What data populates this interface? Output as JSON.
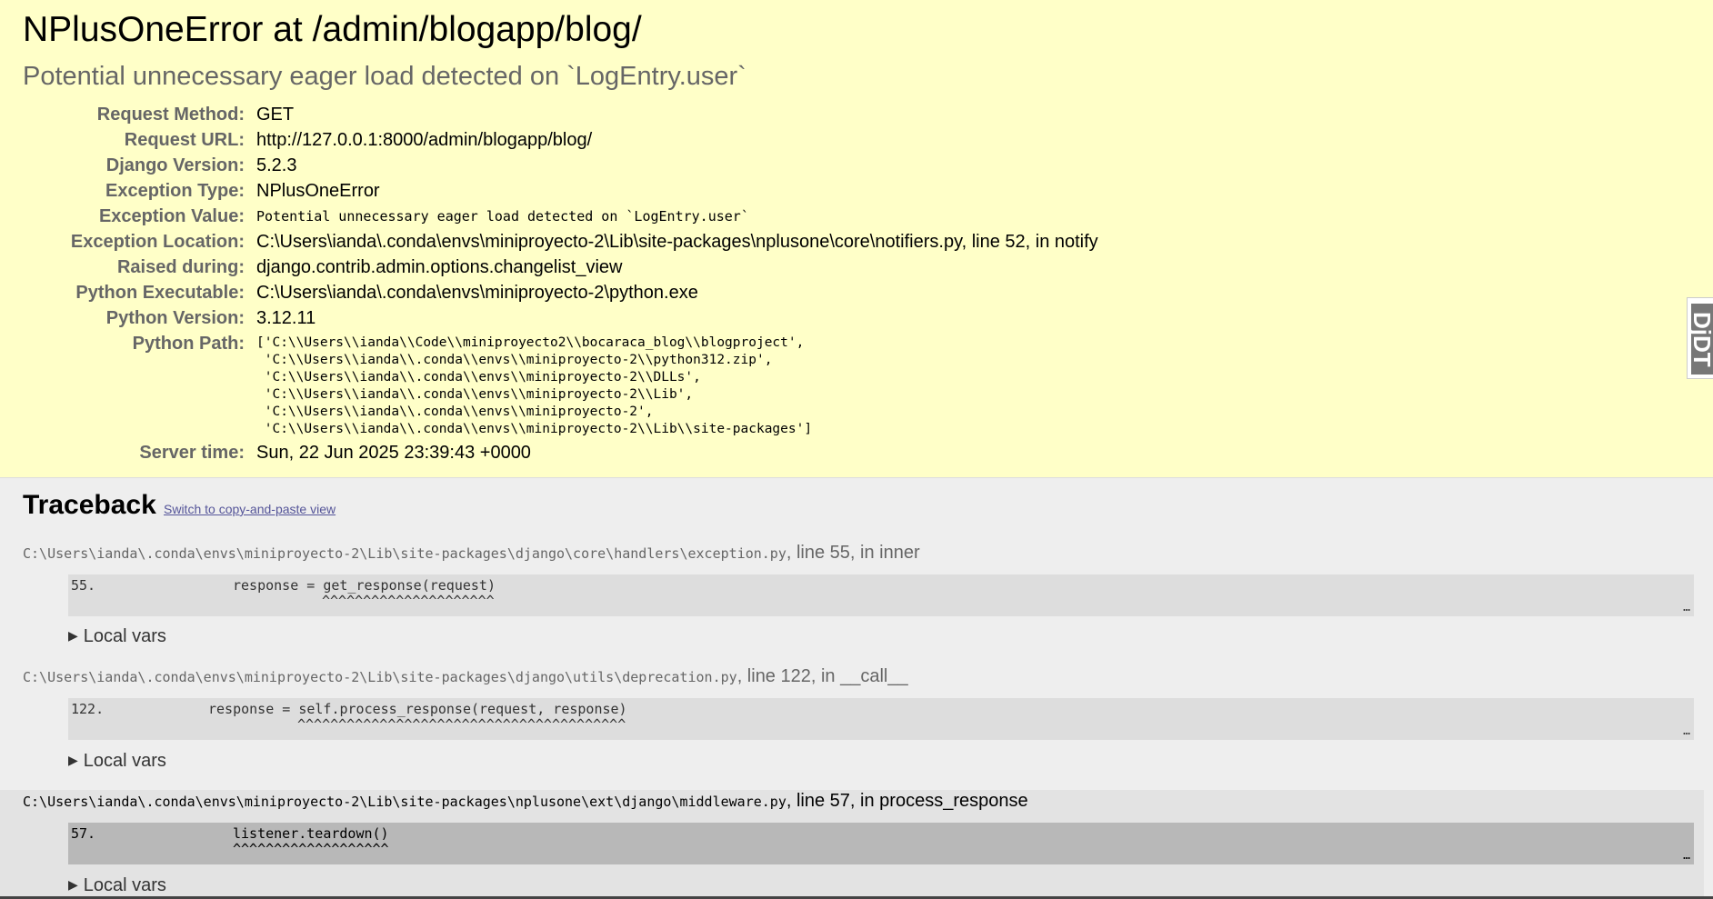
{
  "summary": {
    "title": "NPlusOneError at /admin/blogapp/blog/",
    "subtitle": "Potential unnecessary eager load detected on `LogEntry.user`",
    "meta": [
      {
        "label": "Request Method:",
        "value": "GET"
      },
      {
        "label": "Request URL:",
        "value": "http://127.0.0.1:8000/admin/blogapp/blog/"
      },
      {
        "label": "Django Version:",
        "value": "5.2.3"
      },
      {
        "label": "Exception Type:",
        "value": "NPlusOneError"
      },
      {
        "label": "Exception Value:",
        "value": "Potential unnecessary eager load detected on `LogEntry.user`"
      },
      {
        "label": "Exception Location:",
        "value": "C:\\Users\\ianda\\.conda\\envs\\miniproyecto-2\\Lib\\site-packages\\nplusone\\core\\notifiers.py, line 52, in notify"
      },
      {
        "label": "Raised during:",
        "value": "django.contrib.admin.options.changelist_view"
      },
      {
        "label": "Python Executable:",
        "value": "C:\\Users\\ianda\\.conda\\envs\\miniproyecto-2\\python.exe"
      },
      {
        "label": "Python Version:",
        "value": "3.12.11"
      },
      {
        "label": "Python Path:",
        "value": "['C:\\\\Users\\\\ianda\\\\Code\\\\miniproyecto2\\\\bocaraca_blog\\\\blogproject',\n 'C:\\\\Users\\\\ianda\\\\.conda\\\\envs\\\\miniproyecto-2\\\\python312.zip',\n 'C:\\\\Users\\\\ianda\\\\.conda\\\\envs\\\\miniproyecto-2\\\\DLLs',\n 'C:\\\\Users\\\\ianda\\\\.conda\\\\envs\\\\miniproyecto-2\\\\Lib',\n 'C:\\\\Users\\\\ianda\\\\.conda\\\\envs\\\\miniproyecto-2',\n 'C:\\\\Users\\\\ianda\\\\.conda\\\\envs\\\\miniproyecto-2\\\\Lib\\\\site-packages']"
      },
      {
        "label": "Server time:",
        "value": "Sun, 22 Jun 2025 23:39:43 +0000"
      }
    ]
  },
  "traceback": {
    "heading": "Traceback",
    "switch_link": "Switch to copy-and-paste view",
    "local_vars_label": "Local vars",
    "ellipsis": "…",
    "frames": [
      {
        "file": "C:\\Users\\ianda\\.conda\\envs\\miniproyecto-2\\Lib\\site-packages\\django\\core\\handlers\\exception.py",
        "rest": ", line 55, in inner",
        "line_no": "55.",
        "code": "response = get_response(request)",
        "caret": "^^^^^^^^^^^^^^^^^^^^^"
      },
      {
        "file": "C:\\Users\\ianda\\.conda\\envs\\miniproyecto-2\\Lib\\site-packages\\django\\utils\\deprecation.py",
        "rest": ", line 122, in __call__",
        "line_no": "122.",
        "code": "response = self.process_response(request, response)",
        "caret": "^^^^^^^^^^^^^^^^^^^^^^^^^^^^^^^^^^^^^^^^"
      },
      {
        "file": "C:\\Users\\ianda\\.conda\\envs\\miniproyecto-2\\Lib\\site-packages\\nplusone\\ext\\django\\middleware.py",
        "rest": ", line 57, in process_response",
        "line_no": "57.",
        "code": "listener.teardown()",
        "caret": "^^^^^^^^^^^^^^^^^^^"
      }
    ]
  },
  "toolbar_handle": {
    "label": "DjDT"
  },
  "colors": {
    "summary_bg": "#ffffc8",
    "page_bg": "#eeeeee",
    "context_bg": "#dddddd",
    "active_context_bg": "#b8b8b8",
    "link": "#555599"
  }
}
